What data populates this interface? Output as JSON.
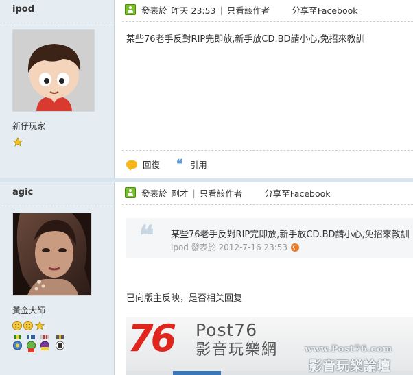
{
  "posts": [
    {
      "username": "ipod",
      "rank": "新仔玩家",
      "meta": {
        "posted_prefix": "發表於",
        "time": "昨天 23:53",
        "separator": "|",
        "only_author": "只看該作者",
        "share": "分享至Facebook"
      },
      "content": "某些76老手反對RIP完即放,新手放CD.BD請小心,免招來教訓",
      "actions": {
        "reply": "回復",
        "quote": "引用"
      }
    },
    {
      "username": "agic",
      "rank": "黃金大師",
      "meta": {
        "posted_prefix": "發表於",
        "time": "剛才",
        "separator": "|",
        "only_author": "只看該作者",
        "share": "分享至Facebook"
      },
      "quote": {
        "text": "某些76老手反對RIP完即放,新手放CD.BD請小心,免招來教訓",
        "meta": "ipod 發表於 2012-7-16 23:53"
      },
      "content": "已向版主反映，是否相关回复"
    }
  ],
  "banner": {
    "number": "76",
    "brand": "Post76",
    "subtitle": "影音玩樂網"
  },
  "watermark": {
    "url": "www.Post76.com",
    "forum": "影音玩樂論壇"
  },
  "colors": {
    "sidebar_bg": "#e5edf2",
    "accent_red": "#e0261c",
    "accent_orange": "#f2a122",
    "link_blue": "#3a76ba"
  }
}
